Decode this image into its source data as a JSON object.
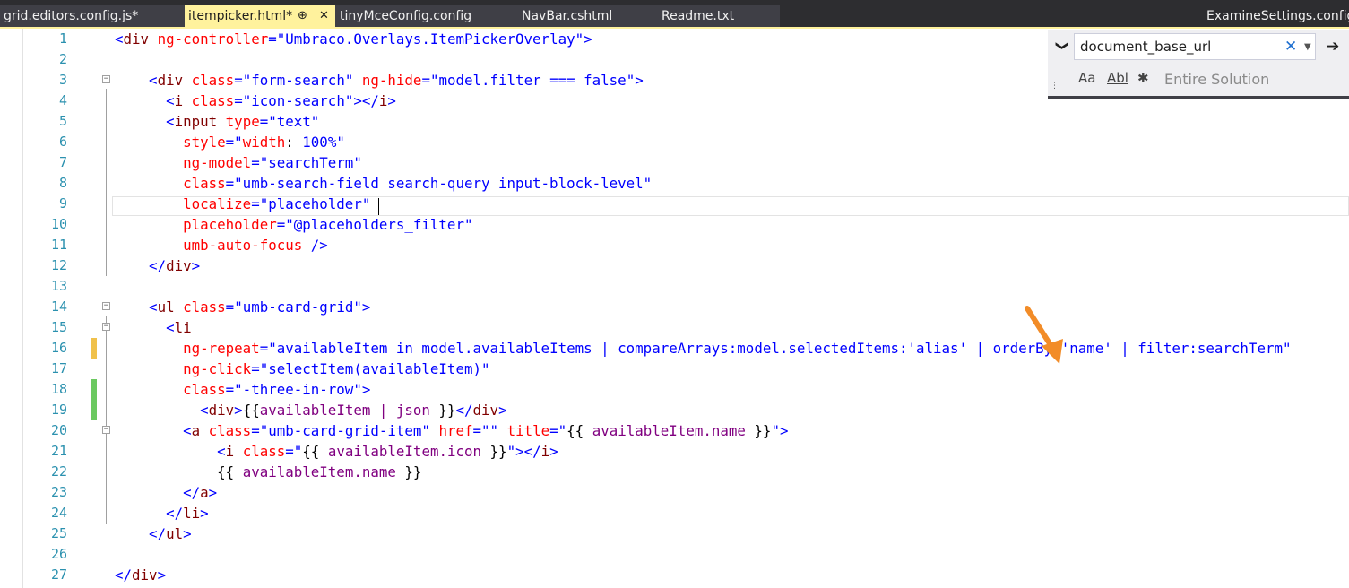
{
  "tabs": [
    {
      "label": "grid.editors.config.js*"
    },
    {
      "label": "itempicker.html*",
      "pin": "⊕",
      "close": "✕"
    },
    {
      "label": "tinyMceConfig.config"
    },
    {
      "label": "NavBar.cshtml"
    },
    {
      "label": "Readme.txt"
    },
    {
      "label": "ExamineSettings.config"
    }
  ],
  "find": {
    "query": "document_base_url",
    "chevron": "❯",
    "clear": "✕",
    "dropdown": "▼",
    "go": "➔",
    "match_case": "Aa",
    "whole_word": "Abl",
    "regex": "✱",
    "scope": "Entire Solution",
    "grip": "⋮"
  },
  "editor": {
    "line_numbers": [
      "1",
      "2",
      "3",
      "4",
      "5",
      "6",
      "7",
      "8",
      "9",
      "10",
      "11",
      "12",
      "13",
      "14",
      "15",
      "16",
      "17",
      "18",
      "19",
      "20",
      "21",
      "22",
      "23",
      "24",
      "25",
      "26",
      "27"
    ],
    "fold_marker": "−"
  },
  "colors": {
    "tag": "#800000",
    "attribute": "#ff0000",
    "value": "#0000ff",
    "line_number": "#2b91af",
    "changed_unsaved": "#f0c14b",
    "changed_saved": "#6bc960",
    "arrow": "#f28c28"
  }
}
